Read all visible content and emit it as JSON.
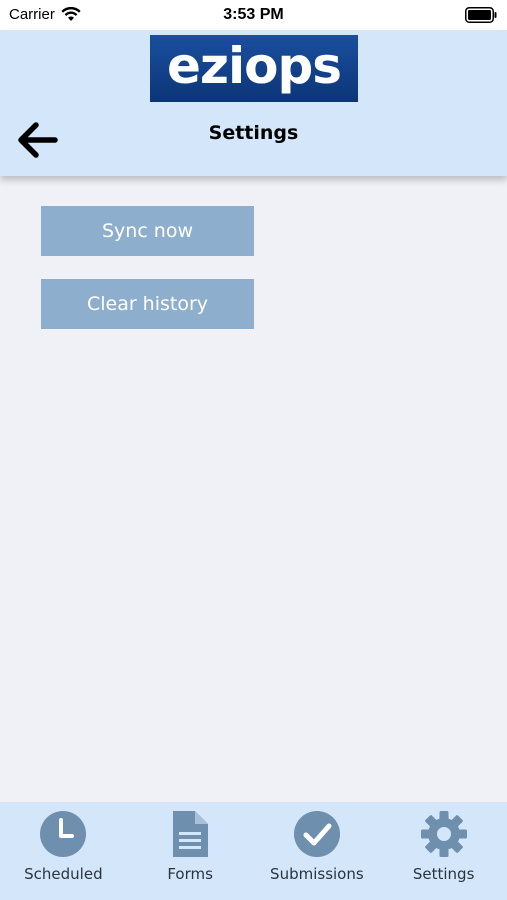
{
  "status_bar": {
    "carrier": "Carrier",
    "time": "3:53 PM",
    "wifi_icon": "wifi-icon",
    "battery_icon": "battery-full-icon"
  },
  "header": {
    "logo_text": "eziops",
    "title": "Settings",
    "back_icon": "arrow-left-icon"
  },
  "actions": {
    "sync_label": "Sync now",
    "clear_label": "Clear history"
  },
  "tabs": [
    {
      "label": "Scheduled",
      "icon": "clock-icon"
    },
    {
      "label": "Forms",
      "icon": "document-icon"
    },
    {
      "label": "Submissions",
      "icon": "checkmark-circle-icon"
    },
    {
      "label": "Settings",
      "icon": "gear-icon"
    }
  ],
  "colors": {
    "header_bg": "#d4e6f9",
    "page_bg": "#eff1f6",
    "button_bg": "#8eaecd",
    "tab_icon": "#6e8fad",
    "logo_bg": "#0c3577"
  }
}
